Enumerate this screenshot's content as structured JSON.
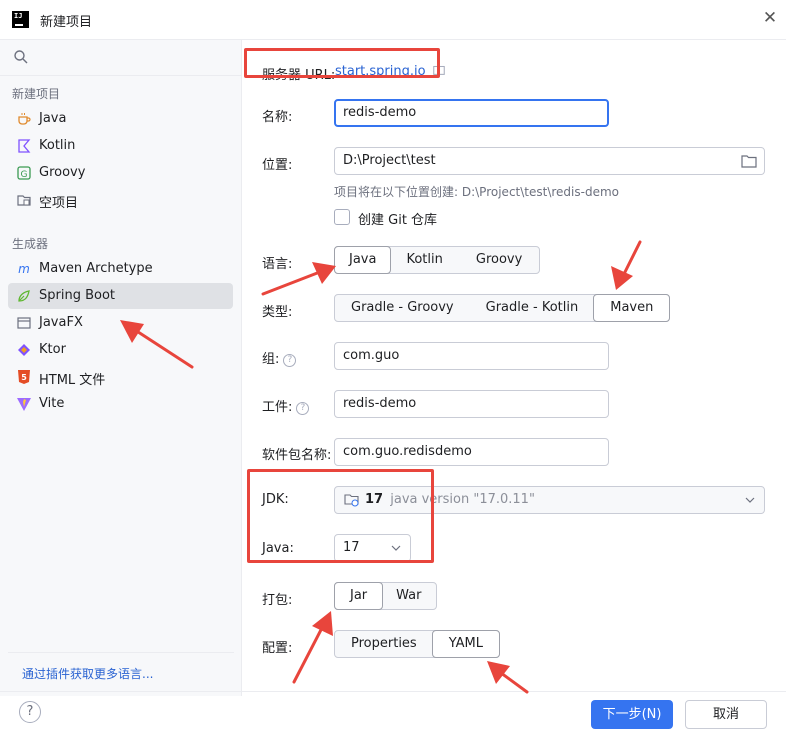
{
  "window": {
    "title": "新建项目",
    "logo_text": "IJ"
  },
  "sidebar": {
    "search_placeholder": "",
    "section_new": "新建项目",
    "new_items": [
      {
        "label": "Java",
        "icon": "cup-icon"
      },
      {
        "label": "Kotlin",
        "icon": "kotlin-icon"
      },
      {
        "label": "Groovy",
        "icon": "groovy-icon"
      },
      {
        "label": "空项目",
        "icon": "empty-project-icon"
      }
    ],
    "section_generators": "生成器",
    "generator_items": [
      {
        "label": "Maven Archetype",
        "icon": "maven-icon"
      },
      {
        "label": "Spring Boot",
        "icon": "spring-icon",
        "selected": true
      },
      {
        "label": "JavaFX",
        "icon": "javafx-icon"
      },
      {
        "label": "Ktor",
        "icon": "ktor-icon"
      },
      {
        "label": "HTML 文件",
        "icon": "html5-icon"
      },
      {
        "label": "Vite",
        "icon": "vite-icon"
      }
    ],
    "plugins_link": "通过插件获取更多语言..."
  },
  "form": {
    "server_url_label": "服务器 URL:",
    "server_url_value": "start.spring.io",
    "name_label": "名称:",
    "name_value": "redis-demo",
    "location_label": "位置:",
    "location_value": "D:\\Project\\test",
    "location_hint": "项目将在以下位置创建: D:\\Project\\test\\redis-demo",
    "git_label": "创建 Git 仓库",
    "git_checked": false,
    "language_label": "语言:",
    "languages": [
      "Java",
      "Kotlin",
      "Groovy"
    ],
    "language_selected": "Java",
    "type_label": "类型:",
    "types": [
      "Gradle - Groovy",
      "Gradle - Kotlin",
      "Maven"
    ],
    "type_selected": "Maven",
    "group_label": "组:",
    "group_value": "com.guo",
    "artifact_label": "工件:",
    "artifact_value": "redis-demo",
    "package_label": "软件包名称:",
    "package_value": "com.guo.redisdemo",
    "jdk_label": "JDK:",
    "jdk_version": "17",
    "jdk_detail": "java version \"17.0.11\"",
    "java_label": "Java:",
    "java_value": "17",
    "packaging_label": "打包:",
    "packagings": [
      "Jar",
      "War"
    ],
    "packaging_selected": "Jar",
    "config_label": "配置:",
    "configs": [
      "Properties",
      "YAML"
    ],
    "config_selected": "YAML"
  },
  "footer": {
    "help": "?",
    "next_label": "下一步(N)",
    "cancel_label": "取消"
  },
  "colors": {
    "accent": "#3574f0",
    "link": "#2a63d2",
    "annotation_red": "#e8453c",
    "sidebar_bg": "#f7f8fa",
    "selected_bg": "#dfe1e5"
  }
}
